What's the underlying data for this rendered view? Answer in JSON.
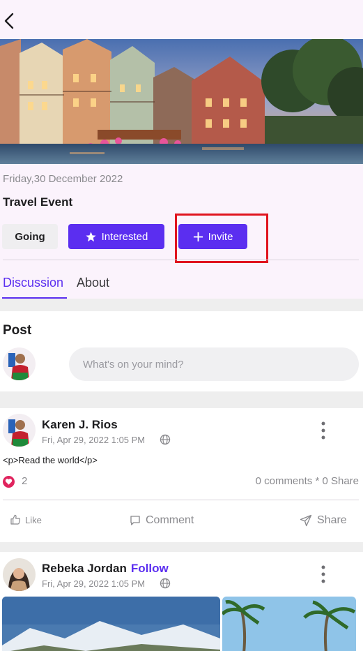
{
  "event": {
    "date": "Friday,30 December 2022",
    "title": "Travel Event",
    "buttons": {
      "going": "Going",
      "interested": "Interested",
      "invite": "Invite"
    }
  },
  "tabs": [
    {
      "label": "Discussion",
      "active": true
    },
    {
      "label": "About",
      "active": false
    }
  ],
  "compose": {
    "heading": "Post",
    "placeholder": "What's on your mind?"
  },
  "posts": [
    {
      "author": "Karen J. Rios",
      "timestamp": "Fri, Apr 29, 2022 1:05 PM",
      "text": "<p>Read the world</p>",
      "reaction_count": "2",
      "stats": "0 comments * 0 Share",
      "actions": {
        "like": "Like",
        "comment": "Comment",
        "share": "Share"
      }
    },
    {
      "author": "Rebeka Jordan",
      "follow": "Follow",
      "timestamp": "Fri, Apr 29, 2022 1:05 PM"
    }
  ],
  "colors": {
    "accent": "#5b2ef0",
    "header_bg": "#fbf3fc",
    "highlight": "#e0141f",
    "heart": "#e0245e"
  },
  "icons": [
    "back-arrow-icon",
    "star-icon",
    "plus-icon",
    "globe-icon",
    "more-vertical-icon",
    "heart-icon",
    "thumbs-up-icon",
    "comment-icon",
    "send-icon"
  ]
}
